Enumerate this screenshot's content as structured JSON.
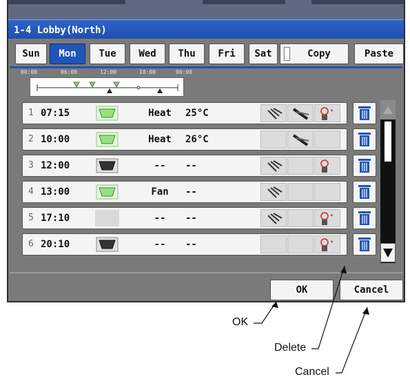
{
  "window": {
    "title": "1-4 Lobby(North)"
  },
  "days": [
    "Sun",
    "Mon",
    "Tue",
    "Wed",
    "Thu",
    "Fri",
    "Sat"
  ],
  "active_day": "Mon",
  "buttons": {
    "copy": "Copy",
    "paste": "Paste",
    "ok": "OK",
    "cancel": "Cancel"
  },
  "timeline": {
    "labels": [
      "00:00",
      "06:00",
      "12:00",
      "18:00",
      "00:00"
    ]
  },
  "schedule_rows": [
    {
      "num": "1",
      "time": "07:15",
      "unit": "on",
      "mode": "Heat",
      "temp": "25°C",
      "icons": [
        "louver-icon",
        "airflow-icon",
        "rc-prohibit-icon"
      ]
    },
    {
      "num": "2",
      "time": "10:00",
      "unit": "on",
      "mode": "Heat",
      "temp": "26°C",
      "icons": [
        "",
        "airflow-icon",
        ""
      ]
    },
    {
      "num": "3",
      "time": "12:00",
      "unit": "off",
      "mode": "--",
      "temp": "--",
      "icons": [
        "louver-icon",
        "",
        "rc-prohibit-icon"
      ]
    },
    {
      "num": "4",
      "time": "13:00",
      "unit": "on",
      "mode": "Fan",
      "temp": "--",
      "icons": [
        "louver-icon",
        "",
        ""
      ]
    },
    {
      "num": "5",
      "time": "17:10",
      "unit": "none",
      "mode": "--",
      "temp": "--",
      "icons": [
        "louver-icon",
        "",
        "rc-prohibit-icon"
      ]
    },
    {
      "num": "6",
      "time": "20:10",
      "unit": "off",
      "mode": "--",
      "temp": "--",
      "icons": [
        "",
        "",
        "rc-prohibit-icon"
      ]
    }
  ],
  "callouts": {
    "ok": "OK",
    "delete": "Delete",
    "cancel": "Cancel"
  },
  "colors": {
    "titlebar": "#1f54b8",
    "active_tab": "#1f54b8",
    "unit_on": "#7ed36e",
    "unit_off": "#333333"
  }
}
